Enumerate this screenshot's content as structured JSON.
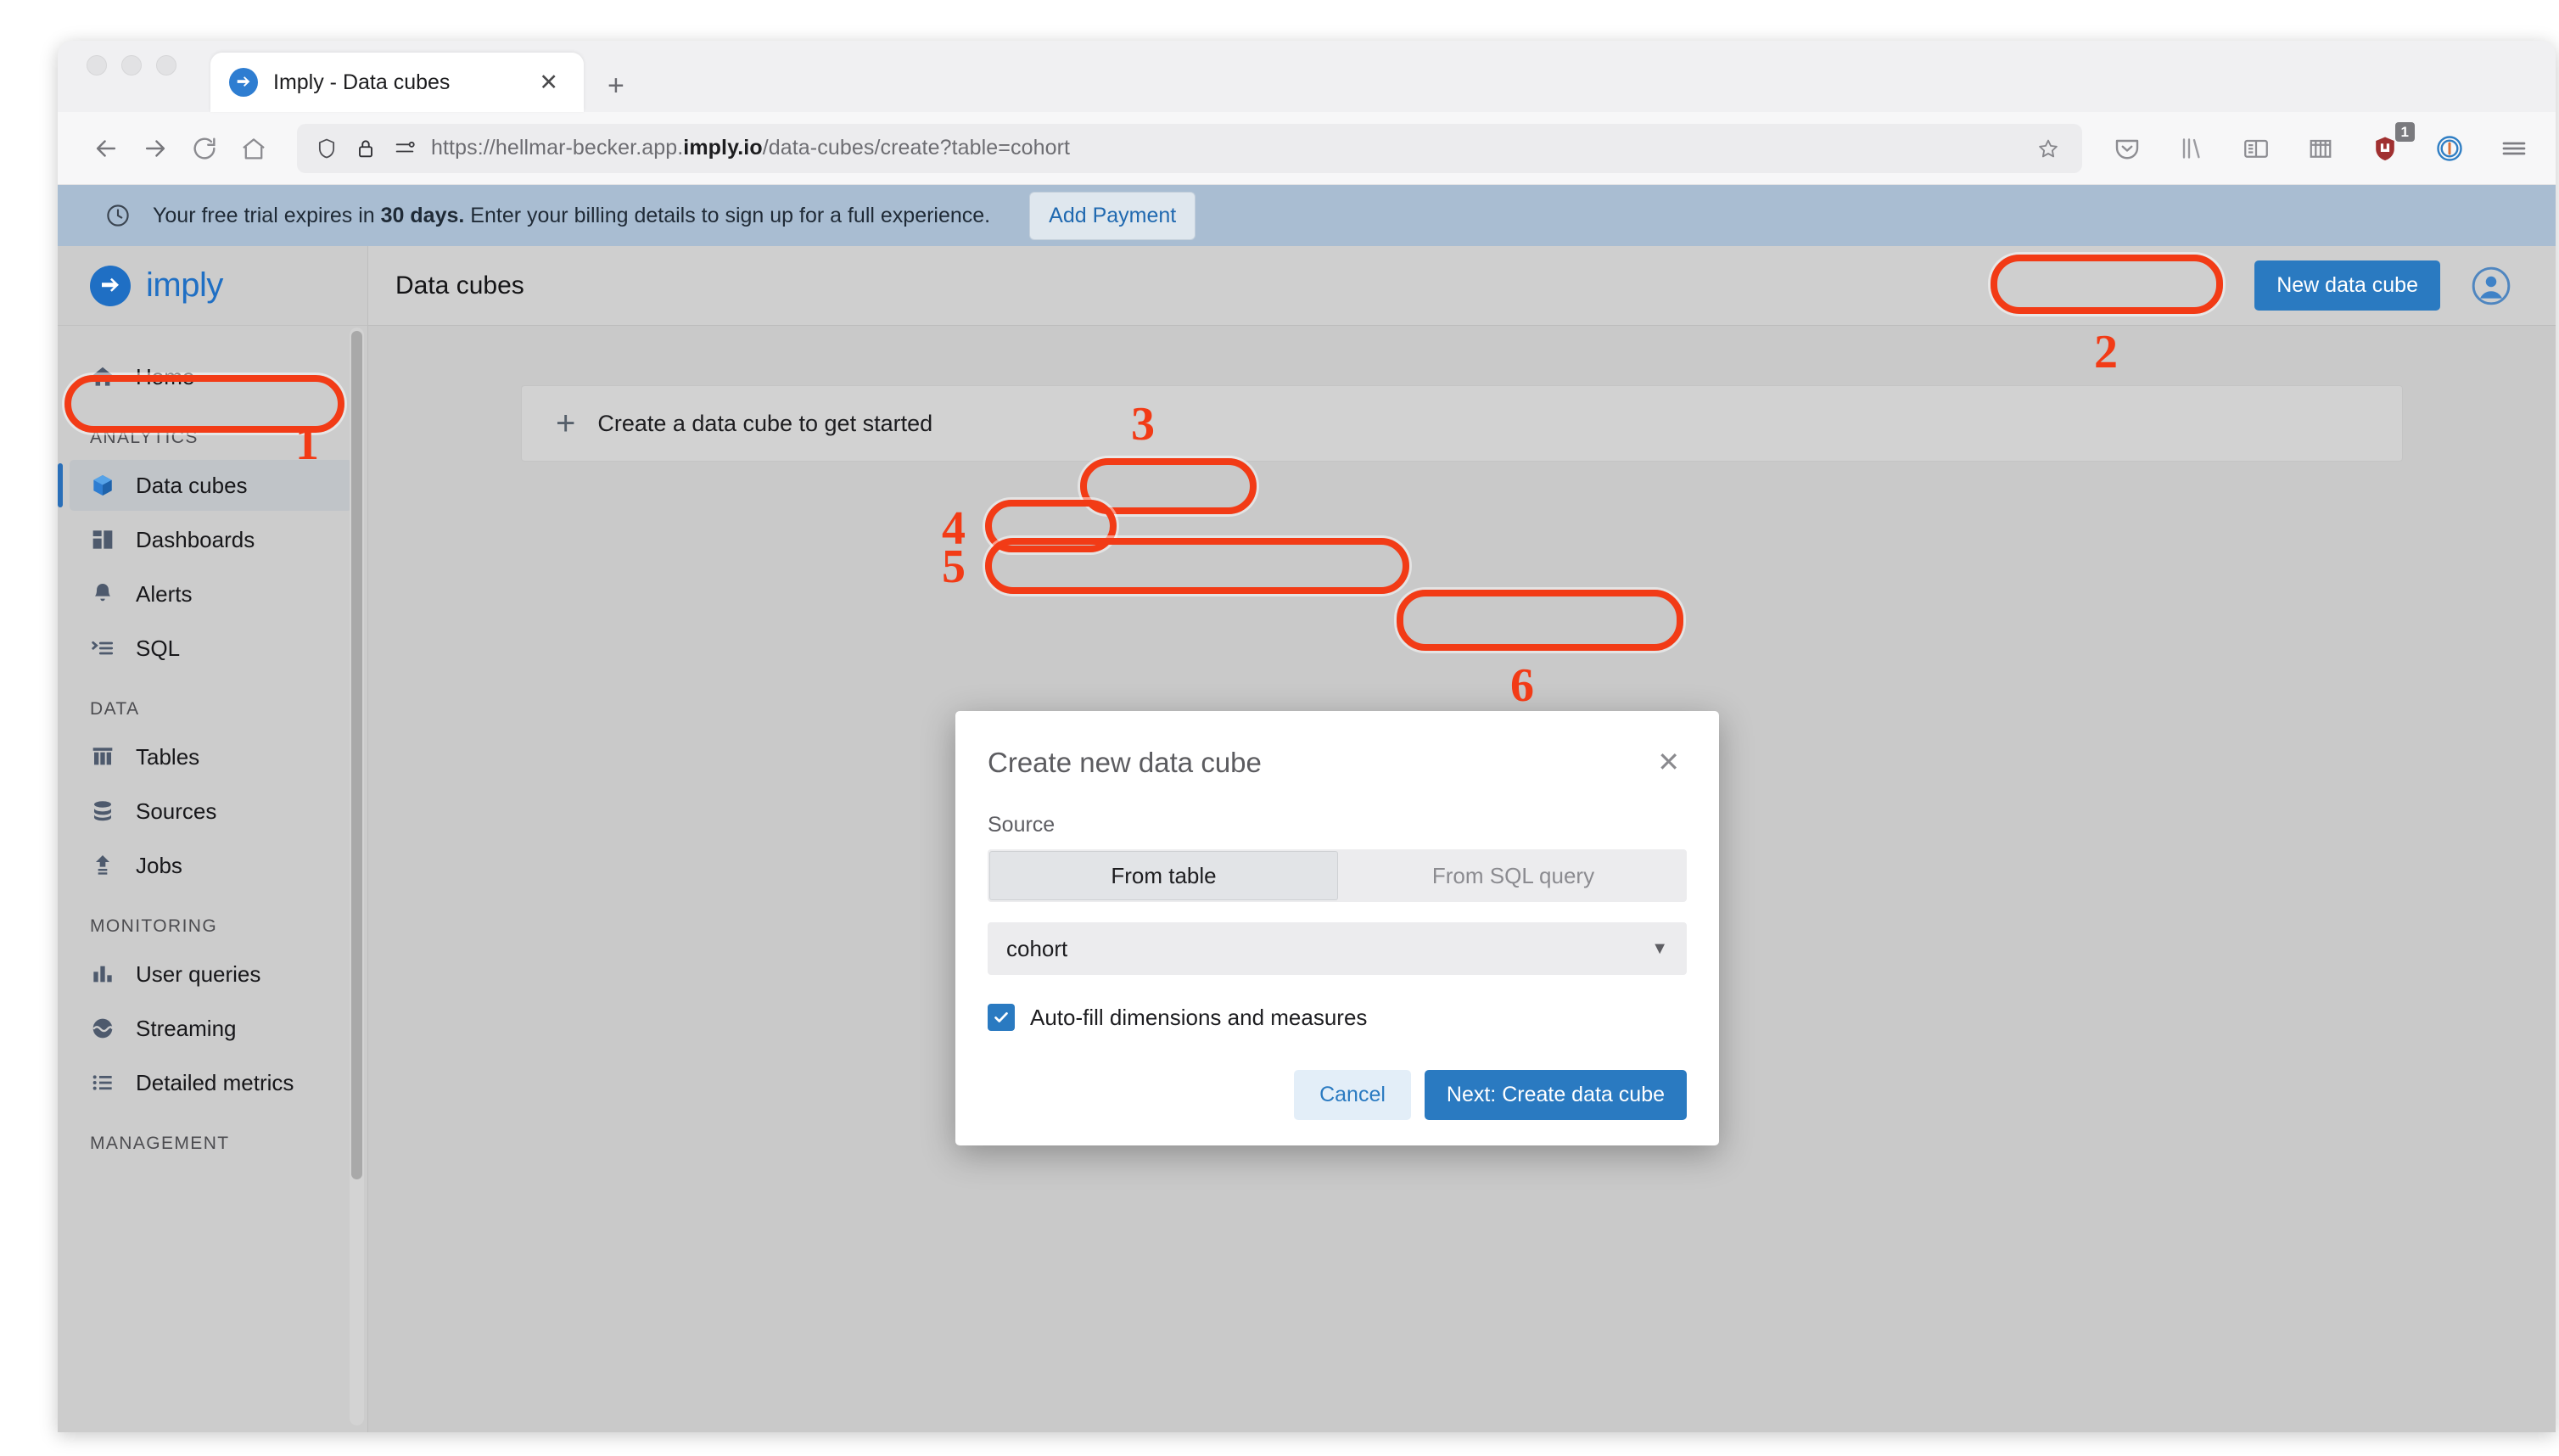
{
  "browser": {
    "tab": {
      "title": "Imply - Data cubes",
      "favicon_icon": "imply-arrow-icon",
      "close_icon": "close-icon"
    },
    "new_tab_icon": "plus-icon",
    "nav": {
      "back_icon": "back-arrow-icon",
      "forward_icon": "forward-arrow-icon",
      "reload_icon": "reload-icon",
      "home_icon": "home-icon"
    },
    "url": {
      "prefix": "https://hellmar-becker.app.",
      "domain": "imply.io",
      "suffix": "/data-cubes/create?table=cohort",
      "full": "https://hellmar-becker.app.imply.io/data-cubes/create?table=cohort",
      "shield_icon": "shield-icon",
      "lock_icon": "lock-icon",
      "permissions_icon": "tracking-protection-icon",
      "bookmark_icon": "star-icon"
    },
    "toolbar_icons": [
      {
        "name": "pocket-icon"
      },
      {
        "name": "library-icon"
      },
      {
        "name": "reader-view-icon"
      },
      {
        "name": "containers-icon"
      },
      {
        "name": "ublock-origin-icon",
        "badge": "1"
      },
      {
        "name": "onepassword-icon"
      },
      {
        "name": "hamburger-menu-icon"
      }
    ]
  },
  "trial_banner": {
    "clock_icon": "clock-icon",
    "text_before": "Your free trial expires in ",
    "text_bold": "30 days.",
    "text_after": " Enter your billing details to sign up for a full experience.",
    "button_label": "Add Payment"
  },
  "sidebar": {
    "brand": {
      "name": "imply",
      "logo_icon": "imply-arrow-icon"
    },
    "groups": [
      {
        "heading": "",
        "items": [
          {
            "label": "Home",
            "icon": "home-icon",
            "active": false
          }
        ]
      },
      {
        "heading": "ANALYTICS",
        "items": [
          {
            "label": "Data cubes",
            "icon": "cube-icon",
            "active": true
          },
          {
            "label": "Dashboards",
            "icon": "dashboard-icon",
            "active": false
          },
          {
            "label": "Alerts",
            "icon": "bell-icon",
            "active": false
          },
          {
            "label": "SQL",
            "icon": "sql-console-icon",
            "active": false
          }
        ]
      },
      {
        "heading": "DATA",
        "items": [
          {
            "label": "Tables",
            "icon": "table-icon",
            "active": false
          },
          {
            "label": "Sources",
            "icon": "database-icon",
            "active": false
          },
          {
            "label": "Jobs",
            "icon": "upload-icon",
            "active": false
          }
        ]
      },
      {
        "heading": "MONITORING",
        "items": [
          {
            "label": "User queries",
            "icon": "bar-chart-icon",
            "active": false
          },
          {
            "label": "Streaming",
            "icon": "stream-icon",
            "active": false
          },
          {
            "label": "Detailed metrics",
            "icon": "list-icon",
            "active": false
          }
        ]
      },
      {
        "heading": "MANAGEMENT",
        "items": []
      }
    ]
  },
  "header": {
    "title": "Data cubes",
    "new_cube_label": "New data cube",
    "avatar_icon": "user-avatar-icon"
  },
  "main": {
    "empty_card_label": "Create a data cube to get started",
    "empty_card_icon": "plus-icon"
  },
  "modal": {
    "title": "Create new data cube",
    "close_icon": "close-icon",
    "source_label": "Source",
    "source_tabs": [
      {
        "label": "From table",
        "selected": true
      },
      {
        "label": "From SQL query",
        "selected": false
      }
    ],
    "table_select": {
      "value": "cohort",
      "caret_icon": "chevron-down-icon"
    },
    "autofill": {
      "label": "Auto-fill dimensions and measures",
      "checked": true,
      "check_icon": "check-icon"
    },
    "cancel_label": "Cancel",
    "next_label": "Next: Create data cube"
  },
  "annotations": {
    "color": "#f23b16",
    "steps": [
      {
        "number": "1",
        "target": "sidebar-item-data-cubes"
      },
      {
        "number": "2",
        "target": "new-data-cube-button"
      },
      {
        "number": "3",
        "target": "source-tab-from-table"
      },
      {
        "number": "4",
        "target": "table-select-value"
      },
      {
        "number": "5",
        "target": "autofill-checkbox-row"
      },
      {
        "number": "6",
        "target": "next-create-data-cube-button"
      }
    ]
  }
}
